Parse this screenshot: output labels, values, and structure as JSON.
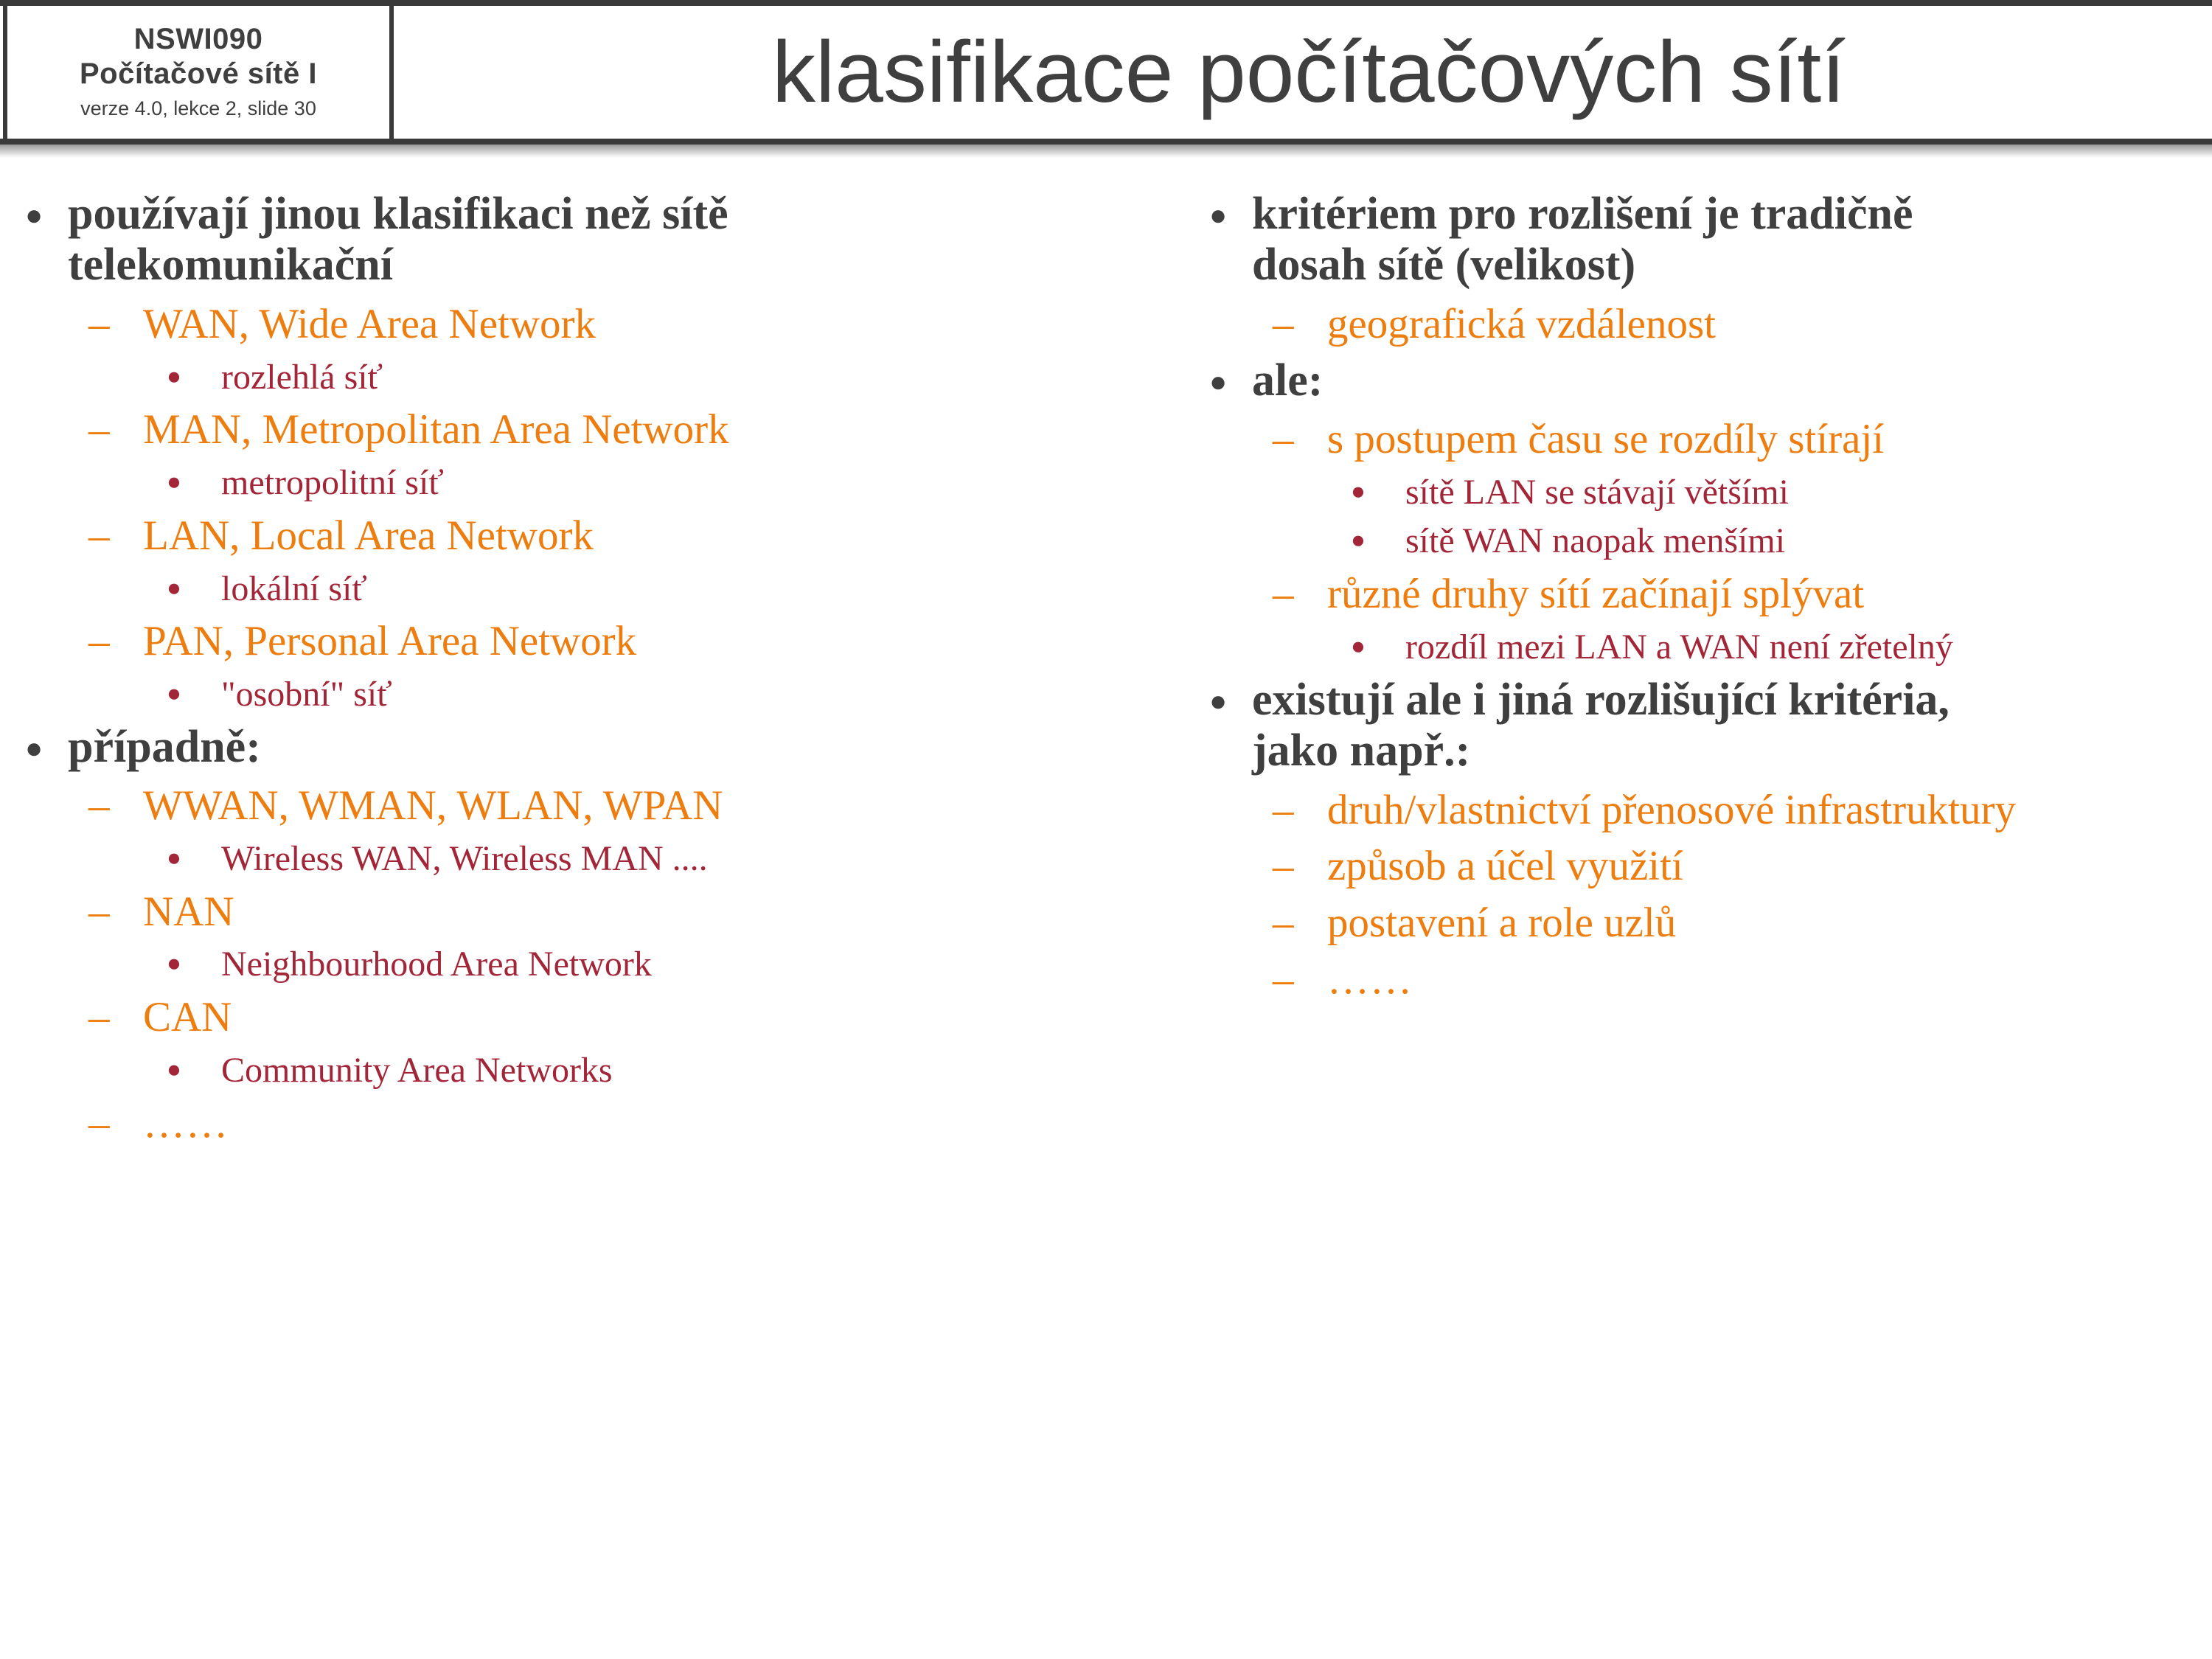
{
  "header": {
    "course_code": "NSWI090",
    "course_name": "Počítačové sítě I",
    "version_line": "verze 4.0, lekce 2, slide 30",
    "title": "klasifikace počítačových sítí"
  },
  "markers": {
    "level1_bullet": "●",
    "level2_dash": "–",
    "level3_bullet": "●"
  },
  "colors": {
    "level1": "#3F3F3F",
    "level2_orange": "#ED7D0E",
    "level3_darkred": "#A32638",
    "rule": "#3A3A3A",
    "background": "#FFFFFF"
  },
  "left_column": {
    "items": [
      {
        "level": 1,
        "text": "používají jinou klasifikaci než sítě telekomunikační"
      },
      {
        "level": 2,
        "text": "WAN, Wide Area Network"
      },
      {
        "level": 3,
        "text": "rozlehlá síť"
      },
      {
        "level": 2,
        "text": "MAN, Metropolitan Area Network"
      },
      {
        "level": 3,
        "text": "metropolitní síť"
      },
      {
        "level": 2,
        "text": "LAN, Local Area Network"
      },
      {
        "level": 3,
        "text": "lokální síť"
      },
      {
        "level": 2,
        "text": "PAN, Personal Area Network"
      },
      {
        "level": 3,
        "text": "\"osobní\" síť"
      },
      {
        "level": 1,
        "text": "případně:"
      },
      {
        "level": 2,
        "text": "WWAN, WMAN, WLAN, WPAN"
      },
      {
        "level": 3,
        "text": "Wireless WAN, Wireless MAN ...."
      },
      {
        "level": 2,
        "text": "NAN"
      },
      {
        "level": 3,
        "text": "Neighbourhood Area Network"
      },
      {
        "level": 2,
        "text": "CAN"
      },
      {
        "level": 3,
        "text": "Community Area Networks"
      },
      {
        "level": 2,
        "text": "……"
      }
    ]
  },
  "right_column": {
    "items": [
      {
        "level": 1,
        "text": "kritériem pro rozlišení je tradičně dosah sítě (velikost)"
      },
      {
        "level": 2,
        "text": "geografická vzdálenost"
      },
      {
        "level": 1,
        "text": "ale:"
      },
      {
        "level": 2,
        "text": "s postupem času se rozdíly stírají"
      },
      {
        "level": 3,
        "text": "sítě LAN se stávají většími"
      },
      {
        "level": 3,
        "text": "sítě WAN naopak menšími"
      },
      {
        "level": 2,
        "text": "různé druhy sítí začínají splývat"
      },
      {
        "level": 3,
        "text": "rozdíl mezi LAN a WAN není zřetelný"
      },
      {
        "level": 1,
        "text": "existují ale i jiná rozlišující kritéria, jako např.:"
      },
      {
        "level": 2,
        "text": "druh/vlastnictví přenosové infrastruktury"
      },
      {
        "level": 2,
        "text": "způsob a účel využití"
      },
      {
        "level": 2,
        "text": "postavení a role uzlů"
      },
      {
        "level": 2,
        "text": "……"
      }
    ]
  }
}
